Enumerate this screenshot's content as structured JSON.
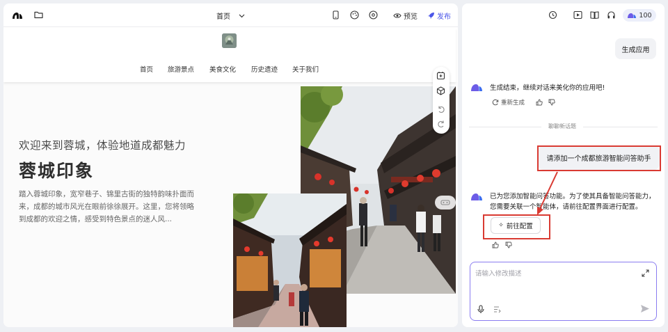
{
  "editor": {
    "page_selector": "首页",
    "preview_label": "预览",
    "publish_label": "发布"
  },
  "site": {
    "nav": [
      "首页",
      "旅游景点",
      "美食文化",
      "历史遗迹",
      "关于我们"
    ],
    "hero_subtitle": "欢迎来到蓉城，体验地道成都魅力",
    "hero_title": "蓉城印象",
    "hero_desc": "踏入蓉城印象，宽窄巷子、锦里古街的独特韵味扑面而来，成都的城市风光在眼前徐徐展开。这里，您将领略到成都的欢迎之情，感受到特色景点的迷人风..."
  },
  "chat": {
    "credits": "100",
    "user_msg_1": "生成应用",
    "ai_msg_1": "生成结束，继续对话来美化你的应用吧!",
    "regenerate_label": "重新生成",
    "divider_label": "聊聊新话题",
    "user_msg_2": "请添加一个成都旅游智能问答助手",
    "ai_msg_2": "已为您添加智能问答功能。为了使其具备智能问答能力，您需要关联一个智能体，请前往配置界面进行配置。",
    "goto_config_label": "前往配置",
    "input_placeholder": "请输入修改描述"
  },
  "colors": {
    "accent": "#4a55e8",
    "highlight": "#d93a32",
    "input_border": "#8a7cf0"
  }
}
